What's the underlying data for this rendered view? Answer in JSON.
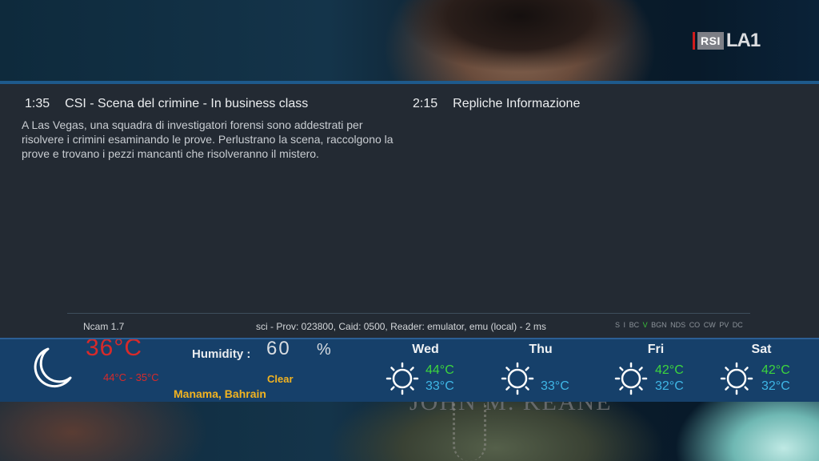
{
  "channel_logo": {
    "left": "RSI",
    "right": "LA1",
    "bar_color": "#d01c1c"
  },
  "epg": {
    "now": {
      "time": "1:35",
      "title": "CSI - Scena del crimine - In business class",
      "description": "A Las Vegas, una squadra di investigatori forensi sono addestrati per risolvere i crimini esaminando le prove. Perlustrano la scena, raccolgono la prove e trovano i pezzi mancanti che risolveranno il mistero."
    },
    "next": {
      "time": "2:15",
      "title": "Repliche Informazione"
    }
  },
  "infobar": {
    "cam": "Ncam 1.7",
    "ecm_info": "sci - Prov: 023800, Caid: 0500, Reader: emulator, emu (local) - 2 ms",
    "caids": [
      "S",
      "I",
      "BC",
      "V",
      "BG",
      "N",
      "NDS",
      "CO",
      "CW",
      "PV",
      "DC"
    ],
    "active_caid": "V"
  },
  "weather": {
    "current_temp": "36°C",
    "range": "44°C - 35°C",
    "humidity_label": "Humidity :",
    "humidity_value": "60",
    "humidity_unit": "%",
    "condition": "Clear",
    "location": "Manama, Bahrain",
    "condition_icon": "moon-icon",
    "forecast": [
      {
        "day": "Wed",
        "high": "44°C",
        "low": "33°C",
        "icon": "sun-icon"
      },
      {
        "day": "Thu",
        "high": "",
        "low": "33°C",
        "icon": "sun-icon"
      },
      {
        "day": "Fri",
        "high": "42°C",
        "low": "32°C",
        "icon": "sun-icon"
      },
      {
        "day": "Sat",
        "high": "42°C",
        "low": "32°C",
        "icon": "sun-icon"
      }
    ]
  },
  "video_overlay": {
    "credit_text": "JOHN M. KEANE"
  },
  "colors": {
    "accent_blue": "#1e5a8c",
    "temp_red": "#d82a2a",
    "high_green": "#3dd63d",
    "low_cyan": "#3fb6e6",
    "location_gold": "#f2b320"
  }
}
